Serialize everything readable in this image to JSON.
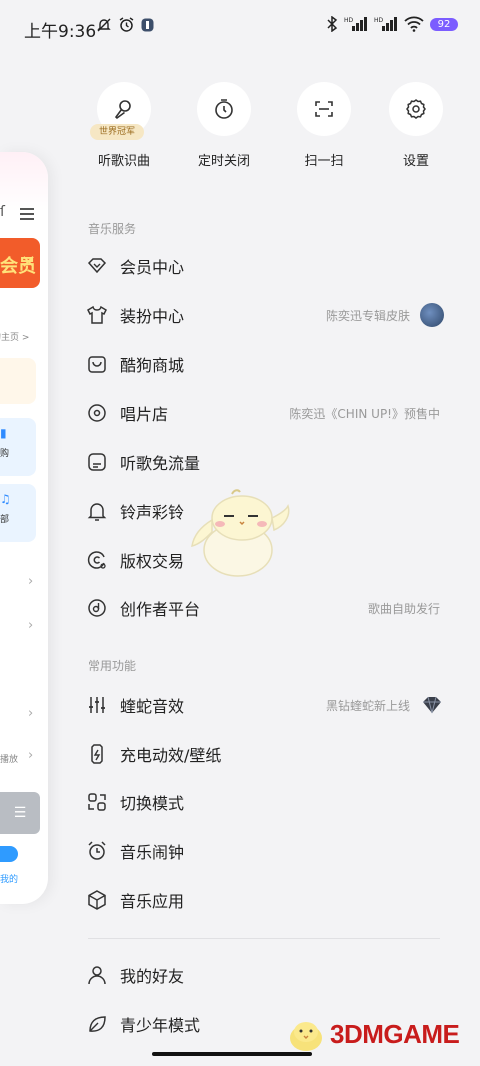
{
  "status_bar": {
    "time": "上午9:36",
    "battery": "92"
  },
  "peek_panel": {
    "banner_text": "会员",
    "profile_link": "的主页 >",
    "card1_text": "购",
    "card2_text": "部",
    "row_text": "播放",
    "bottom_text": "我的"
  },
  "quick_actions": [
    {
      "label": "听歌识曲",
      "badge": "世界冠军",
      "icon": "mic-icon"
    },
    {
      "label": "定时关闭",
      "icon": "timer-icon"
    },
    {
      "label": "扫一扫",
      "icon": "scan-icon"
    },
    {
      "label": "设置",
      "icon": "gear-icon"
    }
  ],
  "sections": {
    "music_services": "音乐服务",
    "common_functions": "常用功能"
  },
  "menu": {
    "vip_center": {
      "label": "会员中心"
    },
    "dress_center": {
      "label": "装扮中心",
      "extra": "陈奕迅专辑皮肤"
    },
    "kugou_mall": {
      "label": "酷狗商城"
    },
    "record_store": {
      "label": "唱片店",
      "extra": "陈奕迅《CHIN UP!》预售中"
    },
    "free_data": {
      "label": "听歌免流量"
    },
    "ringtone": {
      "label": "铃声彩铃"
    },
    "copyright": {
      "label": "版权交易"
    },
    "creator": {
      "label": "创作者平台",
      "extra": "歌曲自助发行"
    },
    "viper_sound": {
      "label": "蝰蛇音效",
      "extra": "黑钻蝰蛇新上线"
    },
    "charging": {
      "label": "充电动效/壁纸"
    },
    "switch_mode": {
      "label": "切换模式"
    },
    "alarm": {
      "label": "音乐闹钟"
    },
    "music_apps": {
      "label": "音乐应用"
    },
    "friends": {
      "label": "我的好友"
    },
    "teen_mode": {
      "label": "青少年模式"
    }
  },
  "watermark": "3DMGAME",
  "colors": {
    "background": "#f3f3f5",
    "badge_bg": "#f6e7c4",
    "badge_text": "#9a6b1e",
    "battery": "#7b5cff",
    "watermark": "#c81c1c"
  }
}
